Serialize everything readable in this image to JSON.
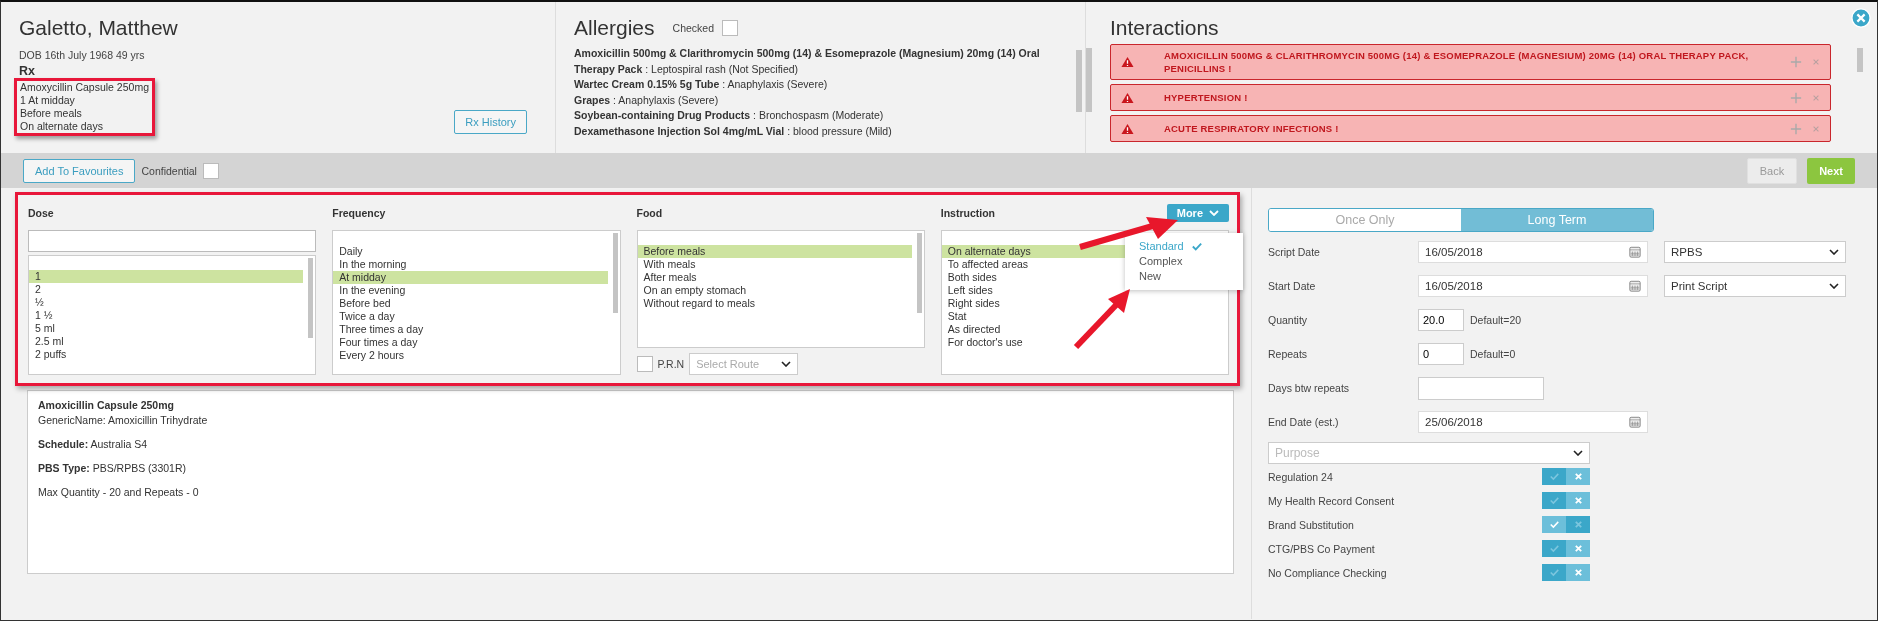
{
  "patient": {
    "name": "Galetto, Matthew",
    "dob": "DOB 16th July 1968 49 yrs",
    "rx_heading": "Rx",
    "rx_lines": [
      "Amoxycillin Capsule 250mg",
      "1 At midday",
      "Before meals",
      "On alternate days"
    ],
    "history_button": "Rx History"
  },
  "allergies": {
    "title": "Allergies",
    "checked_label": "Checked",
    "checked": false,
    "items": [
      "**Amoxicillin 500mg & Clarithromycin 500mg (14) & Esomeprazole (Magnesium) 20mg (14) Oral Therapy Pack** : Leptospiral rash (Not Specified)",
      "**Wartec Cream 0.15% 5g Tube** : Anaphylaxis (Severe)",
      "**Grapes** : Anaphylaxis (Severe)",
      "**Soybean-containing Drug Products** : Bronchospasm (Moderate)",
      "**Dexamethasone Injection Sol 4mg/mL Vial** : blood pressure (Mild)"
    ]
  },
  "interactions": {
    "title": "Interactions",
    "alerts": [
      "AMOXICILLIN 500MG & CLARITHROMYCIN 500MG (14) & ESOMEPRAZOLE (MAGNESIUM) 20MG (14) ORAL THERAPY PACK, PENICILLINS !",
      "HYPERTENSION !",
      "ACUTE RESPIRATORY INFECTIONS !"
    ]
  },
  "toolbar": {
    "favourites_button": "Add To Favourites",
    "confidential_label": "Confidential",
    "confidential": false,
    "back_button": "Back",
    "back_disabled": true,
    "next_button": "Next"
  },
  "editor": {
    "columns": [
      {
        "kind": "dose",
        "label": "Dose",
        "items": [
          {
            "label": "1",
            "selected": true
          },
          {
            "label": "2",
            "selected": false
          },
          {
            "label": "½",
            "selected": false
          },
          {
            "label": "1 ½",
            "selected": false
          },
          {
            "label": "5 ml",
            "selected": false
          },
          {
            "label": "2.5 ml",
            "selected": false
          },
          {
            "label": "2 puffs",
            "selected": false
          }
        ]
      },
      {
        "kind": "frequency",
        "label": "Frequency",
        "items": [
          {
            "label": "Daily",
            "selected": false
          },
          {
            "label": "In the morning",
            "selected": false
          },
          {
            "label": "At midday",
            "selected": true
          },
          {
            "label": "In the evening",
            "selected": false
          },
          {
            "label": "Before bed",
            "selected": false
          },
          {
            "label": "Twice a day",
            "selected": false
          },
          {
            "label": "Three times a day",
            "selected": false
          },
          {
            "label": "Four times a day",
            "selected": false
          },
          {
            "label": "Every 2 hours",
            "selected": false
          }
        ]
      },
      {
        "kind": "food",
        "label": "Food",
        "items": [
          {
            "label": "Before meals",
            "selected": true
          },
          {
            "label": "With meals",
            "selected": false
          },
          {
            "label": "After meals",
            "selected": false
          },
          {
            "label": "On an empty stomach",
            "selected": false
          },
          {
            "label": "Without regard to meals",
            "selected": false
          }
        ]
      },
      {
        "kind": "instruction",
        "label": "Instruction",
        "items": [
          {
            "label": "On alternate days",
            "selected": true
          },
          {
            "label": "To affected areas",
            "selected": false
          },
          {
            "label": "Both sides",
            "selected": false
          },
          {
            "label": "Left sides",
            "selected": false
          },
          {
            "label": "Right sides",
            "selected": false
          },
          {
            "label": "Stat",
            "selected": false
          },
          {
            "label": "As directed",
            "selected": false
          },
          {
            "label": "For doctor's use",
            "selected": false
          }
        ]
      }
    ],
    "more_button": "More",
    "more_menu": [
      {
        "label": "Standard",
        "selected": true
      },
      {
        "label": "Complex",
        "selected": false
      },
      {
        "label": "New",
        "selected": false
      }
    ],
    "prn_label": "P.R.N",
    "prn": false,
    "route_placeholder": "Select Route"
  },
  "details": {
    "title": "Amoxicillin Capsule 250mg",
    "lines": [
      "GenericName: Amoxicillin Trihydrate",
      "**Schedule:** Australia S4",
      "**PBS Type:** PBS/RPBS (3301R)",
      "Max Quantity - 20 and Repeats - 0"
    ]
  },
  "script": {
    "modes": [
      {
        "label": "Once Only",
        "selected": false
      },
      {
        "label": "Long Term",
        "selected": true
      }
    ],
    "fields": [
      {
        "kind": "date",
        "label": "Script Date",
        "value": "16/05/2018",
        "select": "RPBS"
      },
      {
        "kind": "date",
        "label": "Start Date",
        "value": "16/05/2018",
        "select": "Print Script"
      },
      {
        "kind": "number",
        "label": "Quantity",
        "value": "20.0",
        "hint": "Default=20"
      },
      {
        "kind": "number",
        "label": "Repeats",
        "value": "0",
        "hint": "Default=0"
      },
      {
        "kind": "text",
        "label": "Days btw repeats"
      },
      {
        "kind": "date",
        "label": "End Date (est.)",
        "value": "25/06/2018"
      }
    ],
    "purpose_placeholder": "Purpose",
    "flags": [
      {
        "label": "Regulation 24",
        "checked": false
      },
      {
        "label": "My Health Record Consent",
        "checked": false
      },
      {
        "label": "Brand Substitution",
        "checked": true
      },
      {
        "label": "CTG/PBS Co Payment",
        "checked": false
      },
      {
        "label": "No Compliance Checking",
        "checked": false
      }
    ]
  }
}
